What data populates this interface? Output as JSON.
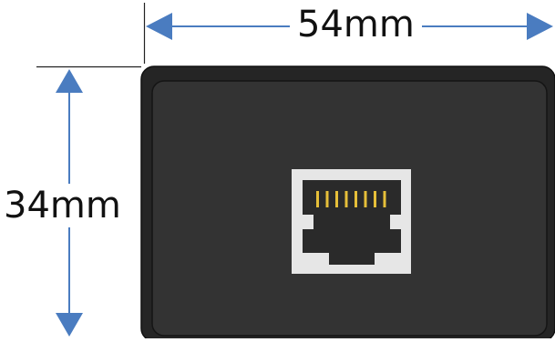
{
  "dimensions": {
    "width_label": "54mm",
    "height_label": "34mm"
  },
  "colors": {
    "arrow": "#4a7cc0",
    "enclosure_outer": "#252525",
    "enclosure_inner": "#333333",
    "port_frame": "#e6e6e6",
    "port_socket": "#2a2a2a",
    "pins": "#e6bf39"
  },
  "device": {
    "port_type": "RJ45 ethernet jack",
    "pin_count": 8
  }
}
